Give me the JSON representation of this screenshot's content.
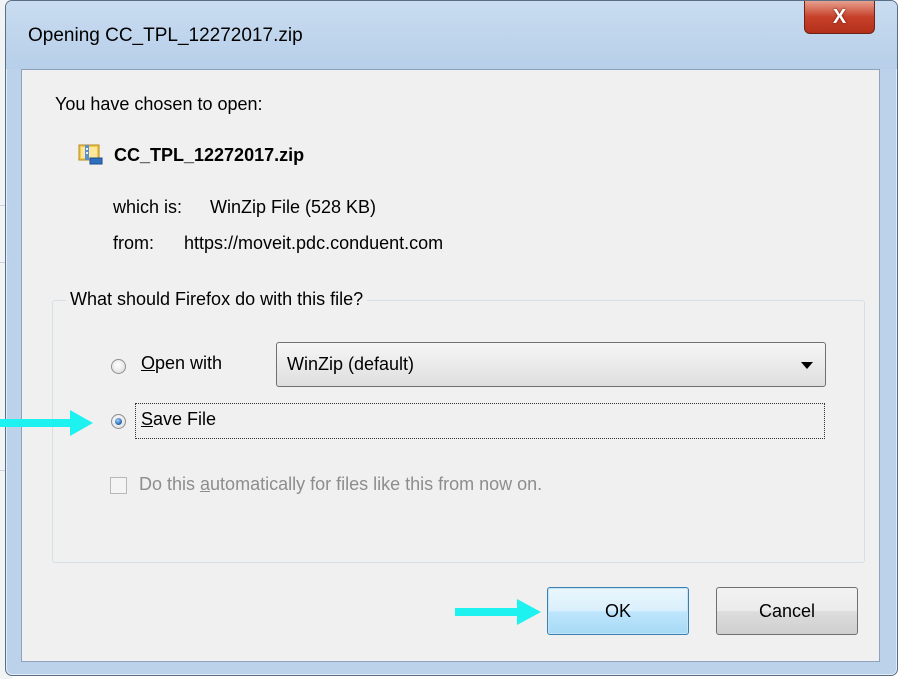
{
  "window": {
    "title": "Opening CC_TPL_12272017.zip",
    "close_label": "X"
  },
  "intro": "You have chosen to open:",
  "file": {
    "icon": "zip-file-icon",
    "name": "CC_TPL_12272017.zip",
    "which_label": "which is:",
    "which_value": "WinZip File (528 KB)",
    "from_label": "from:",
    "from_value": "https://moveit.pdc.conduent.com"
  },
  "group": {
    "label": "What should Firefox do with this file?",
    "open_with": {
      "accel": "O",
      "rest": "pen with",
      "selected": false
    },
    "app_select": {
      "value": "WinZip (default)"
    },
    "save_file": {
      "accel": "S",
      "rest": "ave File",
      "selected": true
    },
    "auto": {
      "pre": "Do this ",
      "accel": "a",
      "post": "utomatically for files like this from now on.",
      "checked": false,
      "enabled": false
    }
  },
  "buttons": {
    "ok": "OK",
    "cancel": "Cancel"
  },
  "annotations": {
    "arrow_color": "#1ef2f0"
  },
  "colors": {
    "titlebar": "#bcd2ea",
    "client": "#f0f0f0",
    "close_button": "#c6402a",
    "ok_border": "#3c7fb1"
  }
}
